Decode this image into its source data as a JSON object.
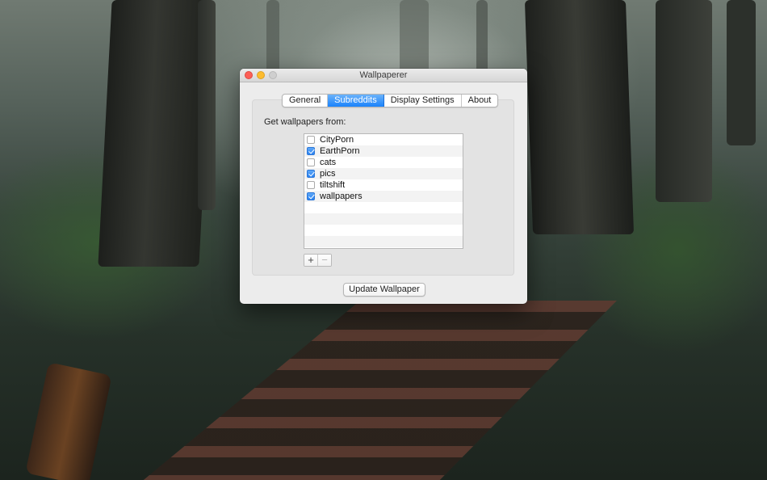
{
  "window": {
    "title": "Wallpaperer"
  },
  "tabs": [
    {
      "label": "General",
      "active": false
    },
    {
      "label": "Subreddits",
      "active": true
    },
    {
      "label": "Display Settings",
      "active": false
    },
    {
      "label": "About",
      "active": false
    }
  ],
  "subreddits": {
    "section_label": "Get wallpapers from:",
    "items": [
      {
        "name": "CityPorn",
        "checked": false
      },
      {
        "name": "EarthPorn",
        "checked": true
      },
      {
        "name": "cats",
        "checked": false
      },
      {
        "name": "pics",
        "checked": true
      },
      {
        "name": "tiltshift",
        "checked": false
      },
      {
        "name": "wallpapers",
        "checked": true
      }
    ],
    "add_label": "+",
    "remove_label": "−"
  },
  "actions": {
    "update_label": "Update Wallpaper"
  },
  "colors": {
    "accent": "#1a82fb",
    "close": "#fc5f57",
    "minimize": "#fdbc2e"
  }
}
